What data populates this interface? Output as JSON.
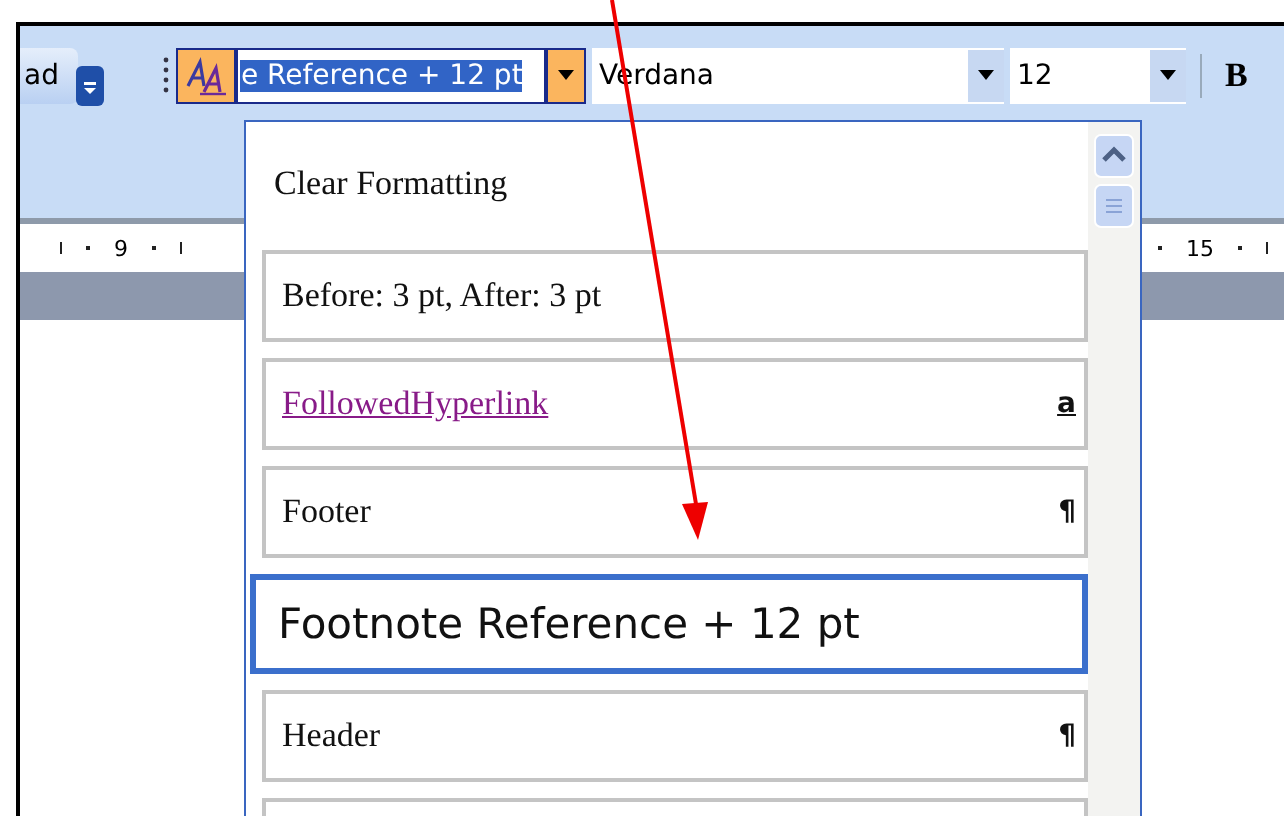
{
  "toolbar": {
    "left_button": "ad",
    "style_field": {
      "value": "e Reference + 12 pt"
    },
    "font_field": {
      "value": "Verdana"
    },
    "size_field": {
      "value": "12"
    },
    "bold_button": {
      "label": "B"
    }
  },
  "ruler": {
    "labels": [
      "9",
      "15"
    ]
  },
  "style_list": {
    "items": [
      {
        "label": "Clear Formatting",
        "kind": "plain",
        "selected": false
      },
      {
        "label": "Before:  3 pt, After:  3 pt",
        "kind": "box",
        "selected": false
      },
      {
        "label": "FollowedHyperlink",
        "kind": "link",
        "mark": "a",
        "selected": false
      },
      {
        "label": "Footer",
        "kind": "box",
        "mark": "¶",
        "selected": false
      },
      {
        "label": "Footnote Reference + 12 pt",
        "kind": "box",
        "selected": true
      },
      {
        "label": "Header",
        "kind": "box",
        "mark": "¶",
        "selected": false
      }
    ]
  }
}
